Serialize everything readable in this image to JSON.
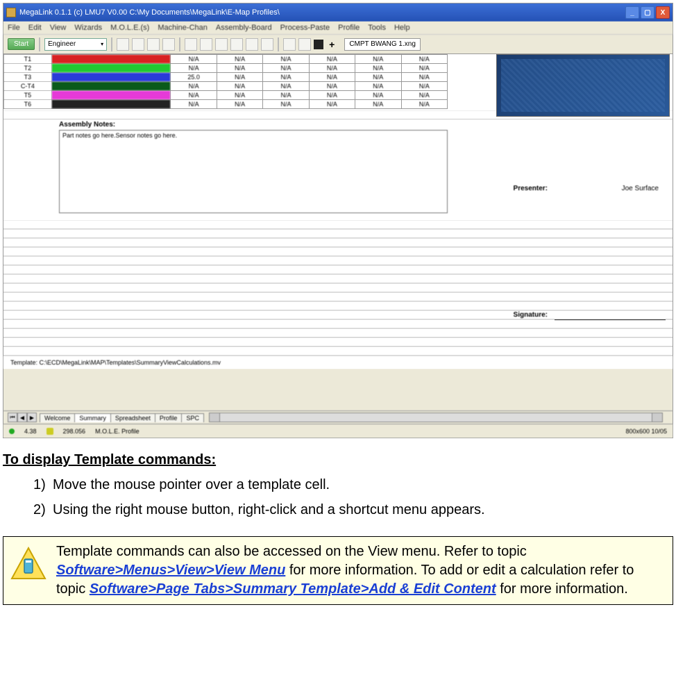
{
  "titlebar": {
    "text": "MegaLink 0.1.1 (c) LMU7 V0.00   C:\\My Documents\\MegaLink\\E-Map Profiles\\"
  },
  "menus": [
    "File",
    "Edit",
    "View",
    "Wizards",
    "M.O.L.E.(s)",
    "Machine-Chan",
    "Assembly-Board",
    "Process-Paste",
    "Profile",
    "Tools",
    "Help"
  ],
  "toolbar": {
    "start_btn": "Start",
    "combo": "Engineer",
    "filename": "CMPT BWANG 1.xng"
  },
  "data_rows": [
    {
      "num": "T1",
      "color": "#d82222",
      "cells": [
        "N/A",
        "N/A",
        "N/A",
        "N/A",
        "N/A",
        "N/A"
      ]
    },
    {
      "num": "T2",
      "color": "#22c832",
      "cells": [
        "N/A",
        "N/A",
        "N/A",
        "N/A",
        "N/A",
        "N/A"
      ]
    },
    {
      "num": "T3",
      "color": "#2a3ad8",
      "cells": [
        "25.0",
        "N/A",
        "N/A",
        "N/A",
        "N/A",
        "N/A"
      ]
    },
    {
      "num": "C-T4",
      "color": "#0a5a1a",
      "cells": [
        "N/A",
        "N/A",
        "N/A",
        "N/A",
        "N/A",
        "N/A"
      ]
    },
    {
      "num": "T5",
      "color": "#e63ad8",
      "cells": [
        "N/A",
        "N/A",
        "N/A",
        "N/A",
        "N/A",
        "N/A"
      ]
    },
    {
      "num": "T6",
      "color": "#222222",
      "cells": [
        "N/A",
        "N/A",
        "N/A",
        "N/A",
        "N/A",
        "N/A"
      ]
    }
  ],
  "assembly": {
    "header": "Assembly Notes:",
    "text": "Part notes go here.Sensor notes go here."
  },
  "side": {
    "presenter_label": "Presenter:",
    "presenter_value": "Joe Surface",
    "signature_label": "Signature:"
  },
  "template_path": "Template: C:\\ECD\\MegaLink\\MAP\\Templates\\SummaryViewCalculations.mv",
  "tabs": [
    "Welcome",
    "Summary",
    "Spreadsheet",
    "Profile",
    "SPC"
  ],
  "status": {
    "left1": "4.38",
    "left2": "298.056",
    "center": "M.O.L.E. Profile",
    "right": "800x600   10/05"
  },
  "instructions": {
    "heading": "To display Template commands:",
    "steps": [
      "Move the mouse pointer over a template cell.",
      "Using the right mouse button, right-click and a shortcut menu appears."
    ]
  },
  "infobox": {
    "pre1": "Template commands can also be accessed on the View menu. Refer to topic ",
    "link1": "Software>Menus>View>View Menu",
    "mid1": " for more information. To add or edit a calculation refer to topic ",
    "link2": "Software>Page Tabs>Summary Template>Add & Edit Content",
    "post": " for more information."
  }
}
